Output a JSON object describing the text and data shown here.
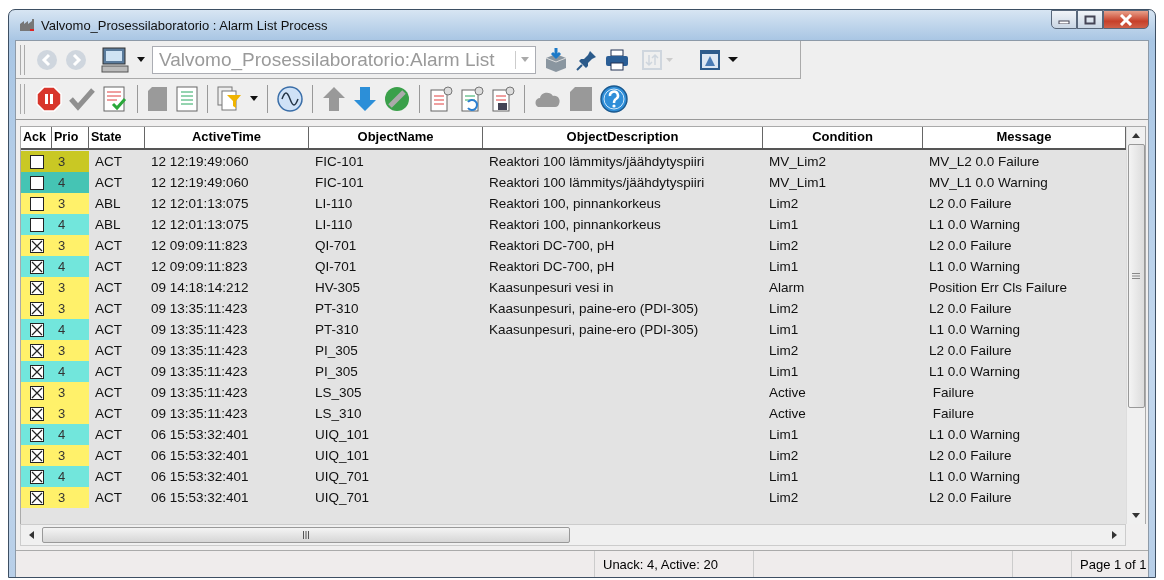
{
  "window": {
    "title": "Valvomo_Prosessilaboratorio : Alarm List Process"
  },
  "address": {
    "value": "Valvomo_Prosessilaboratorio:Alarm List"
  },
  "table": {
    "columns": [
      "Ack",
      "Prio",
      "State",
      "ActiveTime",
      "ObjectName",
      "ObjectDescription",
      "Condition",
      "Message"
    ],
    "rows": [
      {
        "checked": false,
        "prio": "3",
        "color": "#c9c824",
        "state": "ACT",
        "time": "12 12:19:49:060",
        "object": "FIC-101",
        "description": "Reaktori 100 lämmitys/jäähdytyspiiri",
        "condition": "MV_Lim2",
        "message": "MV_L2 0.0 Failure"
      },
      {
        "checked": false,
        "prio": "4",
        "color": "#45c4b4",
        "state": "ACT",
        "time": "12 12:19:49:060",
        "object": "FIC-101",
        "description": "Reaktori 100 lämmitys/jäähdytyspiiri",
        "condition": "MV_Lim1",
        "message": "MV_L1 0.0 Warning"
      },
      {
        "checked": false,
        "prio": "3",
        "color": "#fff16a",
        "state": "ABL",
        "time": "12 12:01:13:075",
        "object": "LI-110",
        "description": "Reaktori 100, pinnankorkeus",
        "condition": "Lim2",
        "message": "L2 0.0 Failure"
      },
      {
        "checked": false,
        "prio": "4",
        "color": "#72e6dc",
        "state": "ABL",
        "time": "12 12:01:13:075",
        "object": "LI-110",
        "description": "Reaktori 100, pinnankorkeus",
        "condition": "Lim1",
        "message": "L1 0.0 Warning"
      },
      {
        "checked": true,
        "prio": "3",
        "color": "#fff16a",
        "state": "ACT",
        "time": "12 09:09:11:823",
        "object": "QI-701",
        "description": "Reaktori DC-700, pH",
        "condition": "Lim2",
        "message": "L2 0.0 Failure"
      },
      {
        "checked": true,
        "prio": "4",
        "color": "#72e6dc",
        "state": "ACT",
        "time": "12 09:09:11:823",
        "object": "QI-701",
        "description": "Reaktori DC-700, pH",
        "condition": "Lim1",
        "message": "L1 0.0 Warning"
      },
      {
        "checked": true,
        "prio": "3",
        "color": "#fff16a",
        "state": "ACT",
        "time": "09 14:18:14:212",
        "object": "HV-305",
        "description": "Kaasunpesuri vesi in",
        "condition": "Alarm",
        "message": "Position Err Cls Failure"
      },
      {
        "checked": true,
        "prio": "3",
        "color": "#fff16a",
        "state": "ACT",
        "time": "09 13:35:11:423",
        "object": "PT-310",
        "description": "Kaasunpesuri, paine-ero (PDI-305)",
        "condition": "Lim2",
        "message": "L2 0.0 Failure"
      },
      {
        "checked": true,
        "prio": "4",
        "color": "#72e6dc",
        "state": "ACT",
        "time": "09 13:35:11:423",
        "object": "PT-310",
        "description": "Kaasunpesuri, paine-ero (PDI-305)",
        "condition": "Lim1",
        "message": "L1 0.0 Warning"
      },
      {
        "checked": true,
        "prio": "3",
        "color": "#fff16a",
        "state": "ACT",
        "time": "09 13:35:11:423",
        "object": "PI_305",
        "condition": "Lim2",
        "message": "L2 0.0 Failure"
      },
      {
        "checked": true,
        "prio": "4",
        "color": "#72e6dc",
        "state": "ACT",
        "time": "09 13:35:11:423",
        "object": "PI_305",
        "condition": "Lim1",
        "message": "L1 0.0 Warning"
      },
      {
        "checked": true,
        "prio": "3",
        "color": "#fff16a",
        "state": "ACT",
        "time": "09 13:35:11:423",
        "object": "LS_305",
        "condition": "Active",
        "message": " Failure"
      },
      {
        "checked": true,
        "prio": "3",
        "color": "#fff16a",
        "state": "ACT",
        "time": "09 13:35:11:423",
        "object": "LS_310",
        "condition": "Active",
        "message": " Failure"
      },
      {
        "checked": true,
        "prio": "4",
        "color": "#72e6dc",
        "state": "ACT",
        "time": "06 15:53:32:401",
        "object": "UIQ_101",
        "condition": "Lim1",
        "message": "L1 0.0 Warning"
      },
      {
        "checked": true,
        "prio": "3",
        "color": "#fff16a",
        "state": "ACT",
        "time": "06 15:53:32:401",
        "object": "UIQ_101",
        "condition": "Lim2",
        "message": "L2 0.0 Failure"
      },
      {
        "checked": true,
        "prio": "4",
        "color": "#72e6dc",
        "state": "ACT",
        "time": "06 15:53:32:401",
        "object": "UIQ_701",
        "condition": "Lim1",
        "message": "L1 0.0 Warning"
      },
      {
        "checked": true,
        "prio": "3",
        "color": "#fff16a",
        "state": "ACT",
        "time": "06 15:53:32:401",
        "object": "UIQ_701",
        "condition": "Lim2",
        "message": "L2 0.0 Failure"
      }
    ]
  },
  "status_bar": {
    "counts": "Unack: 4, Active: 20",
    "page": "Page 1 of 1"
  }
}
